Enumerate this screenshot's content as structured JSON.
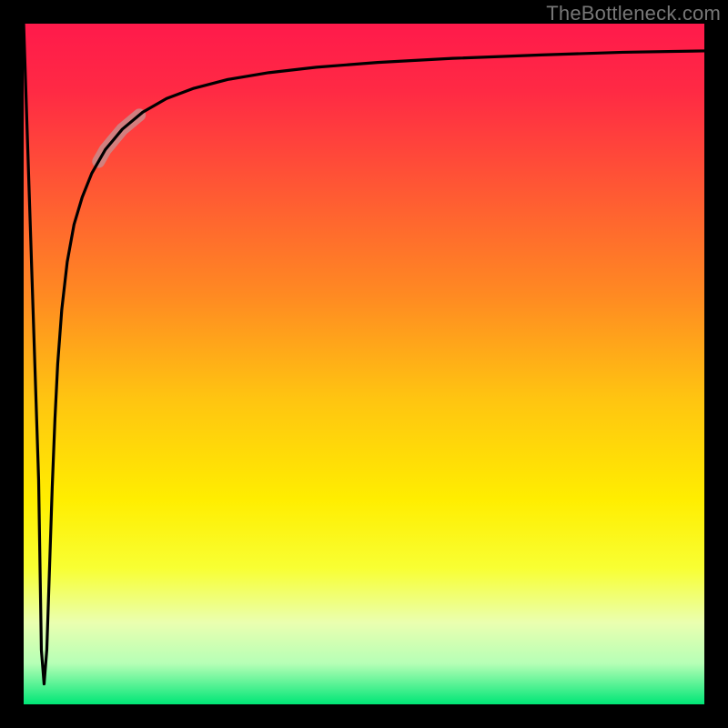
{
  "watermark": "TheBottleneck.com",
  "chart_data": {
    "type": "line",
    "title": "",
    "xlabel": "",
    "ylabel": "",
    "xlim": [
      0,
      100
    ],
    "ylim": [
      0,
      100
    ],
    "grid": false,
    "legend": false,
    "background_gradient": {
      "stops": [
        {
          "offset": 0.0,
          "color": "#ff1a4b"
        },
        {
          "offset": 0.1,
          "color": "#ff2a44"
        },
        {
          "offset": 0.25,
          "color": "#ff5a33"
        },
        {
          "offset": 0.4,
          "color": "#ff8a22"
        },
        {
          "offset": 0.55,
          "color": "#ffc411"
        },
        {
          "offset": 0.7,
          "color": "#ffee00"
        },
        {
          "offset": 0.8,
          "color": "#f8ff33"
        },
        {
          "offset": 0.88,
          "color": "#eaffb0"
        },
        {
          "offset": 0.94,
          "color": "#b6ffb6"
        },
        {
          "offset": 1.0,
          "color": "#00e676"
        }
      ]
    },
    "series": [
      {
        "name": "curve",
        "x": [
          0.0,
          2.2,
          2.6,
          3.0,
          3.4,
          3.8,
          4.2,
          4.6,
          5.0,
          5.6,
          6.4,
          7.4,
          8.6,
          10.0,
          12.0,
          14.5,
          17.5,
          21.0,
          25.0,
          30.0,
          36.0,
          43.0,
          52.0,
          63.0,
          76.0,
          88.0,
          100.0
        ],
        "y": [
          100.0,
          33.0,
          8.0,
          3.0,
          8.0,
          20.0,
          32.0,
          42.0,
          50.0,
          58.0,
          65.0,
          70.5,
          74.5,
          78.0,
          81.5,
          84.5,
          87.0,
          89.0,
          90.5,
          91.8,
          92.8,
          93.6,
          94.3,
          94.9,
          95.4,
          95.8,
          96.0
        ]
      }
    ],
    "highlight_segment": {
      "series": "curve",
      "x_start": 11.0,
      "x_end": 17.0,
      "color": "#c98b8b",
      "width": 14
    },
    "frame": {
      "color": "#000000",
      "width": 26
    }
  }
}
